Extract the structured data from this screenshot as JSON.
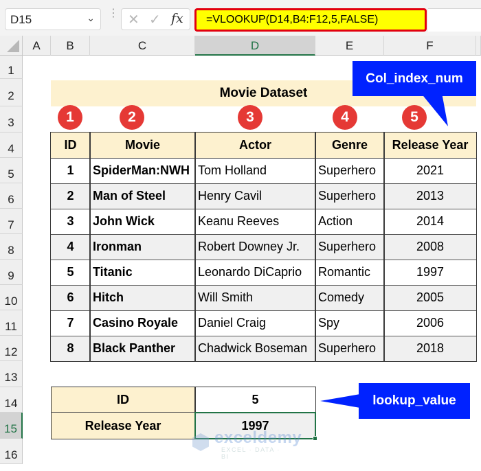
{
  "formula_bar": {
    "name_box": "D15",
    "cancel_icon": "x-icon",
    "enter_icon": "check-icon",
    "fx_label": "fx",
    "formula": "=VLOOKUP(D14,B4:F12,5,FALSE)"
  },
  "columns": [
    "A",
    "B",
    "C",
    "D",
    "E",
    "F"
  ],
  "selected_column": "D",
  "rows": [
    "1",
    "2",
    "3",
    "4",
    "5",
    "6",
    "7",
    "8",
    "9",
    "10",
    "11",
    "12",
    "13",
    "14",
    "15",
    "16"
  ],
  "selected_row": "15",
  "sheet": {
    "title": "Movie Dataset",
    "badges": [
      "1",
      "2",
      "3",
      "4",
      "5"
    ],
    "headers": [
      "ID",
      "Movie",
      "Actor",
      "Genre",
      "Release Year"
    ],
    "records": [
      {
        "id": "1",
        "movie": "SpiderMan:NWH",
        "actor": "Tom Holland",
        "genre": "Superhero",
        "year": "2021"
      },
      {
        "id": "2",
        "movie": "Man of Steel",
        "actor": "Henry Cavil",
        "genre": "Superhero",
        "year": "2013"
      },
      {
        "id": "3",
        "movie": "John Wick",
        "actor": "Keanu Reeves",
        "genre": "Action",
        "year": "2014"
      },
      {
        "id": "4",
        "movie": "Ironman",
        "actor": "Robert Downey Jr.",
        "genre": "Superhero",
        "year": "2008"
      },
      {
        "id": "5",
        "movie": "Titanic",
        "actor": "Leonardo DiCaprio",
        "genre": "Romantic",
        "year": "1997"
      },
      {
        "id": "6",
        "movie": "Hitch",
        "actor": "Will Smith",
        "genre": "Comedy",
        "year": "2005"
      },
      {
        "id": "7",
        "movie": "Casino Royale",
        "actor": "Daniel Craig",
        "genre": "Spy",
        "year": "2006"
      },
      {
        "id": "8",
        "movie": "Black Panther",
        "actor": "Chadwick Boseman",
        "genre": "Superhero",
        "year": "2018"
      }
    ],
    "lookup": {
      "id_label": "ID",
      "id_value": "5",
      "result_label": "Release Year",
      "result_value": "1997"
    }
  },
  "callouts": {
    "col_index": "Col_index_num",
    "lookup_value": "lookup_value"
  },
  "watermark": {
    "name": "exceldemy",
    "tagline": "EXCEL · DATA · BI"
  },
  "colors": {
    "header_fill": "#fdf1cf",
    "formula_highlight": "#ffff00",
    "formula_border": "#e2000f",
    "callout": "#0022ff",
    "badge": "#e53935",
    "selection": "#217346"
  }
}
